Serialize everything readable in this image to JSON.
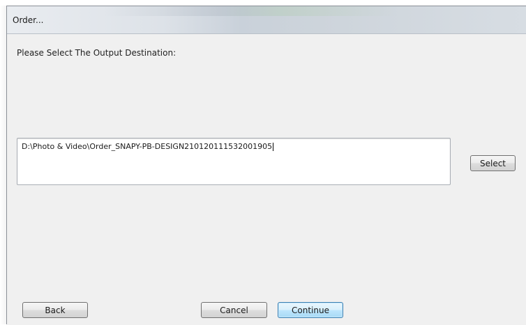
{
  "window": {
    "title": "Order..."
  },
  "dialog": {
    "prompt": "Please Select The Output Destination:",
    "path_value": "D:\\Photo & Video\\Order_SNAPY-PB-DESIGN210120111532001905"
  },
  "buttons": {
    "select_label": "Select",
    "back_label": "Back",
    "cancel_label": "Cancel",
    "continue_label": "Continue"
  },
  "colors": {
    "dialog_background": "#f0f0f0",
    "default_button_accent": "#3c7fb1"
  }
}
